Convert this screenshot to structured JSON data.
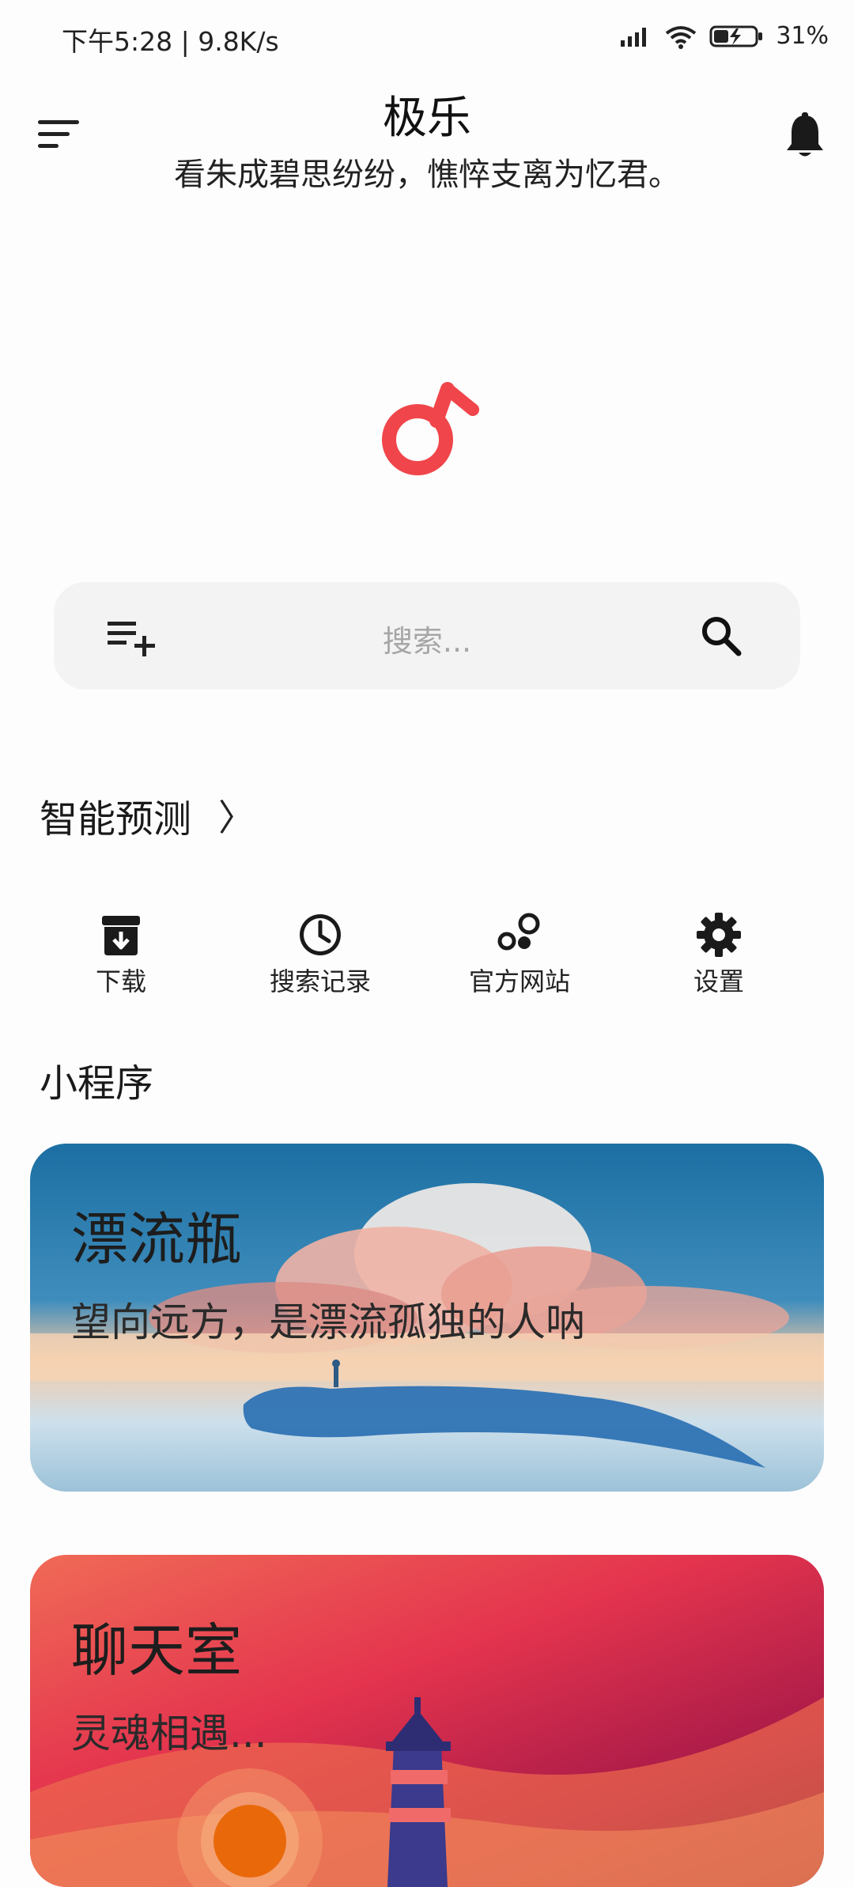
{
  "status_bar": {
    "time": "下午5:28 | 9.8K/s",
    "battery": "31%"
  },
  "header": {
    "title": "极乐",
    "subtitle": "看朱成碧思纷纷，憔悴支离为忆君。"
  },
  "icons": {
    "menu": "menu-icon",
    "bell": "bell-icon",
    "logo": "music-note-logo",
    "add_playlist": "playlist-add-icon",
    "search": "search-icon"
  },
  "search": {
    "placeholder": "搜索..."
  },
  "predict": {
    "label": "智能预测",
    "arrow": "〉"
  },
  "quick_actions": [
    {
      "label": "下载",
      "icon": "download-icon"
    },
    {
      "label": "搜索记录",
      "icon": "history-icon"
    },
    {
      "label": "官方网站",
      "icon": "bubbles-icon"
    },
    {
      "label": "设置",
      "icon": "gear-icon"
    }
  ],
  "mini_programs": {
    "heading": "小程序",
    "cards": [
      {
        "title": "漂流瓶",
        "subtitle": "望向远方，是漂流孤独的人呐"
      },
      {
        "title": "聊天室",
        "subtitle": "灵魂相遇..."
      }
    ]
  },
  "colors": {
    "accent": "#f0454a",
    "search_bg": "#f3f3f3",
    "card1_sky": "#1c6fa3",
    "card2_top": "#f06a56"
  }
}
